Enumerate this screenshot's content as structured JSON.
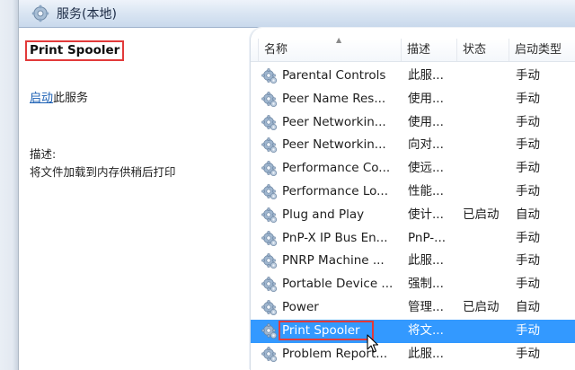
{
  "header": {
    "title": "服务(本地)"
  },
  "details": {
    "service_name": "Print Spooler",
    "start_link": "启动",
    "start_suffix": "此服务",
    "description_label": "描述:",
    "description_text": "将文件加载到内存供稍后打印"
  },
  "columns": {
    "name": "名称",
    "description": "描述",
    "status": "状态",
    "startup_type": "启动类型"
  },
  "services": [
    {
      "name": "Parental Controls",
      "description": "此服...",
      "status": "",
      "startup": "手动",
      "selected": false
    },
    {
      "name": "Peer Name Res...",
      "description": "使用...",
      "status": "",
      "startup": "手动",
      "selected": false
    },
    {
      "name": "Peer Networkin...",
      "description": "使用...",
      "status": "",
      "startup": "手动",
      "selected": false
    },
    {
      "name": "Peer Networkin...",
      "description": "向对...",
      "status": "",
      "startup": "手动",
      "selected": false
    },
    {
      "name": "Performance Co...",
      "description": "使远...",
      "status": "",
      "startup": "手动",
      "selected": false
    },
    {
      "name": "Performance Lo...",
      "description": "性能...",
      "status": "",
      "startup": "手动",
      "selected": false
    },
    {
      "name": "Plug and Play",
      "description": "使计...",
      "status": "已启动",
      "startup": "自动",
      "selected": false
    },
    {
      "name": "PnP-X IP Bus En...",
      "description": "PnP-...",
      "status": "",
      "startup": "手动",
      "selected": false
    },
    {
      "name": "PNRP Machine ...",
      "description": "此服...",
      "status": "",
      "startup": "手动",
      "selected": false
    },
    {
      "name": "Portable Device ...",
      "description": "强制...",
      "status": "",
      "startup": "手动",
      "selected": false
    },
    {
      "name": "Power",
      "description": "管理...",
      "status": "已启动",
      "startup": "自动",
      "selected": false
    },
    {
      "name": "Print Spooler",
      "description": "将文...",
      "status": "",
      "startup": "手动",
      "selected": true
    },
    {
      "name": "Problem Report...",
      "description": "此服...",
      "status": "",
      "startup": "手动",
      "selected": false
    }
  ],
  "colors": {
    "selection": "#3399ff",
    "highlight_border": "#e23a3a",
    "link": "#1a5fb4"
  },
  "icons": {
    "header": "gear-icon",
    "service": "gear-icon",
    "cursor": "mouse-cursor-icon"
  }
}
